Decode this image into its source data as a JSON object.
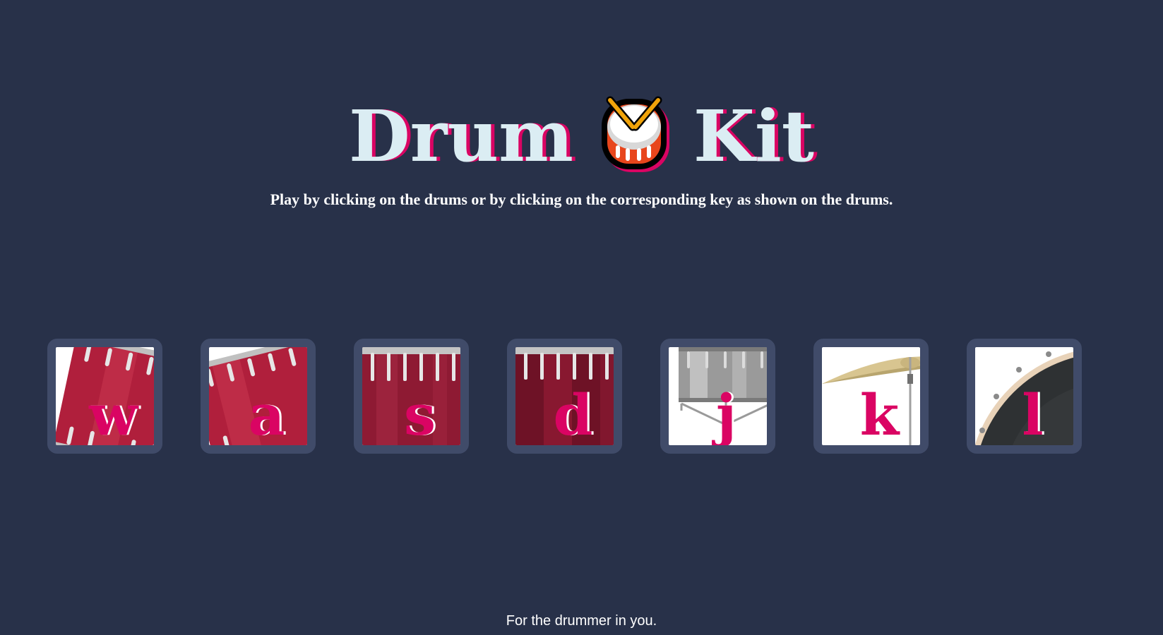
{
  "header": {
    "title_word_1": "Drum",
    "title_word_2": "Kit",
    "emoji_icon": "drum-emoji-icon"
  },
  "instructions": "Play by clicking on the drums or by clicking on the corresponding key as shown on the drums.",
  "drums": [
    {
      "key": "w",
      "icon": "tom-1-drum-icon"
    },
    {
      "key": "a",
      "icon": "tom-2-drum-icon"
    },
    {
      "key": "s",
      "icon": "tom-3-drum-icon"
    },
    {
      "key": "d",
      "icon": "tom-4-drum-icon"
    },
    {
      "key": "j",
      "icon": "snare-drum-icon"
    },
    {
      "key": "k",
      "icon": "crash-cymbal-icon"
    },
    {
      "key": "l",
      "icon": "kick-drum-icon"
    }
  ],
  "footer": "For the drummer in you.",
  "colors": {
    "background": "#283149",
    "title_text": "#dbedf3",
    "accent_pink": "#da0463",
    "drum_frame": "#404b69",
    "drum_red": "#b01f3c",
    "drum_dark_red": "#7a1428"
  }
}
